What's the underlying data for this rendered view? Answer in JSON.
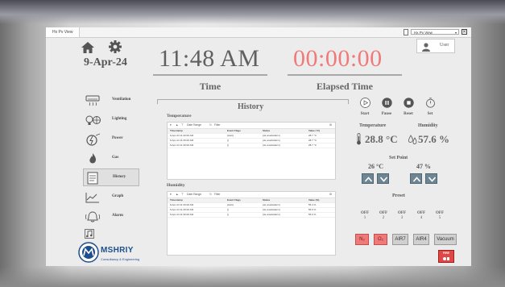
{
  "window": {
    "tab_title": "Hx Pv View",
    "selector_value": "Hx Pv View",
    "close_glyph": "✕"
  },
  "header": {
    "date": "9-Apr-24",
    "time_value": "11:48 AM",
    "time_label": "Time",
    "elapsed_value": "00:00:00",
    "elapsed_label": "Elapsed Time",
    "user_label": "User"
  },
  "sidebar": {
    "items": [
      {
        "label": "Ventilation",
        "icon": "ventilation-icon"
      },
      {
        "label": "Lighting",
        "icon": "lighting-icon"
      },
      {
        "label": "Power",
        "icon": "power-icon"
      },
      {
        "label": "Gas",
        "icon": "gas-icon"
      },
      {
        "label": "History",
        "icon": "history-icon",
        "active": true
      },
      {
        "label": "Graph",
        "icon": "graph-icon"
      },
      {
        "label": "Alarm",
        "icon": "alarm-icon"
      }
    ]
  },
  "logo": {
    "name": "MSHRIY",
    "tagline": "Consultancy & Engineering"
  },
  "history": {
    "title": "History",
    "temperature": {
      "label": "Temperature",
      "toolbar": {
        "date_range": "Date Range",
        "filter": "Filter"
      },
      "columns": [
        "Timestamp",
        "Event Flags",
        "Status",
        "Value (°C)"
      ],
      "rows": [
        [
          "9-Apr-24 11:20:00 AM",
          "{start}",
          "{ok,unackAlarm}",
          "28.7 °C"
        ],
        [
          "9-Apr-24 11:25:00 AM",
          "{}",
          "{ok,unackAlarm}",
          "28.7 °C"
        ],
        [
          "9-Apr-24 11:30:00 AM",
          "{}",
          "{ok,unackAlarm}",
          "28.7 °C"
        ]
      ]
    },
    "humidity": {
      "label": "Humidity",
      "toolbar": {
        "date_range": "Date Range",
        "filter": "Filter"
      },
      "columns": [
        "Timestamp",
        "Event Flags",
        "Status",
        "Value (%)"
      ],
      "rows": [
        [
          "9-Apr-24 11:20:00 AM",
          "{start}",
          "{ok,unackAlarm}",
          "55.4 %"
        ],
        [
          "9-Apr-24 11:25:00 AM",
          "{}",
          "{ok,unackAlarm}",
          "55.6 %"
        ],
        [
          "9-Apr-24 11:30:00 AM",
          "{}",
          "{ok,unackAlarm}",
          "55.6 %"
        ]
      ]
    }
  },
  "controls": {
    "start_label": "Start",
    "pause_label": "Pause",
    "reset_label": "Reset",
    "set_label": "Set"
  },
  "measurements": {
    "temperature_label": "Temperature",
    "temperature_value": "28.8 °C",
    "humidity_label": "Humidity",
    "humidity_value": "57.6 %"
  },
  "setpoint": {
    "title": "Set Point",
    "temperature_value": "26 °C",
    "humidity_value": "47 %"
  },
  "preset": {
    "title": "Preset",
    "items": [
      {
        "state": "OFF",
        "number": "1"
      },
      {
        "state": "OFF",
        "number": "2"
      },
      {
        "state": "OFF",
        "number": "3"
      },
      {
        "state": "OFF",
        "number": "4"
      },
      {
        "state": "OFF",
        "number": "5"
      }
    ]
  },
  "gases": {
    "n2": "N₂",
    "o2": "O₂",
    "air7": "AIR7",
    "air4": "AIR4",
    "vacuum": "Vacuum"
  },
  "fire": {
    "label": "FIRE"
  },
  "colors": {
    "accent_red": "#f07a7a",
    "arrow_button": "#6e8593",
    "logo_blue": "#1e4f8c"
  }
}
